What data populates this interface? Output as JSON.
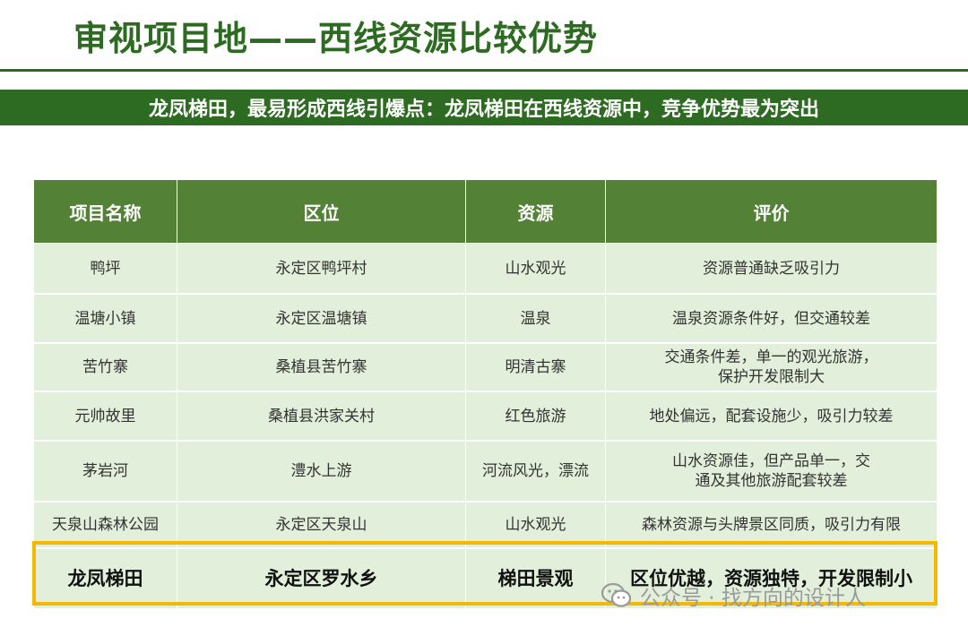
{
  "title": "审视项目地——西线资源比较优势",
  "banner": "龙凤梯田，最易形成西线引爆点：龙凤梯田在西线资源中，竞争优势最为突出",
  "table": {
    "headers": [
      "项目名称",
      "区位",
      "资源",
      "评价"
    ],
    "rows": [
      {
        "name": "鸭坪",
        "location": "永定区鸭坪村",
        "resource": "山水观光",
        "evaluation": "资源普通缺乏吸引力"
      },
      {
        "name": "温塘小镇",
        "location": "永定区温塘镇",
        "resource": "温泉",
        "evaluation": "温泉资源条件好，但交通较差"
      },
      {
        "name": "苦竹寨",
        "location": "桑植县苦竹寨",
        "resource": "明清古寨",
        "evaluation": "交通条件差，单一的观光旅游，保护开发限制大"
      },
      {
        "name": "元帅故里",
        "location": "桑植县洪家关村",
        "resource": "红色旅游",
        "evaluation": "地处偏远，配套设施少，吸引力较差"
      },
      {
        "name": "茅岩河",
        "location": "澧水上游",
        "resource": "河流风光，漂流",
        "evaluation": "山水资源佳，但产品单一，交通及其他旅游配套较差"
      },
      {
        "name": "天泉山森林公园",
        "location": "永定区天泉山",
        "resource": "山水观光",
        "evaluation": "森林资源与头牌景区同质，吸引力有限"
      },
      {
        "name": "龙凤梯田",
        "location": "永定区罗水乡",
        "resource": "梯田景观",
        "evaluation": "区位优越，资源独特，开发限制小"
      }
    ]
  },
  "watermark": "公众号 · 找方向的设计人",
  "colors": {
    "title_green": "#2e6b22",
    "header_green": "#538135",
    "row_bg": "#e2efda",
    "highlight_border": "#f5b800"
  }
}
